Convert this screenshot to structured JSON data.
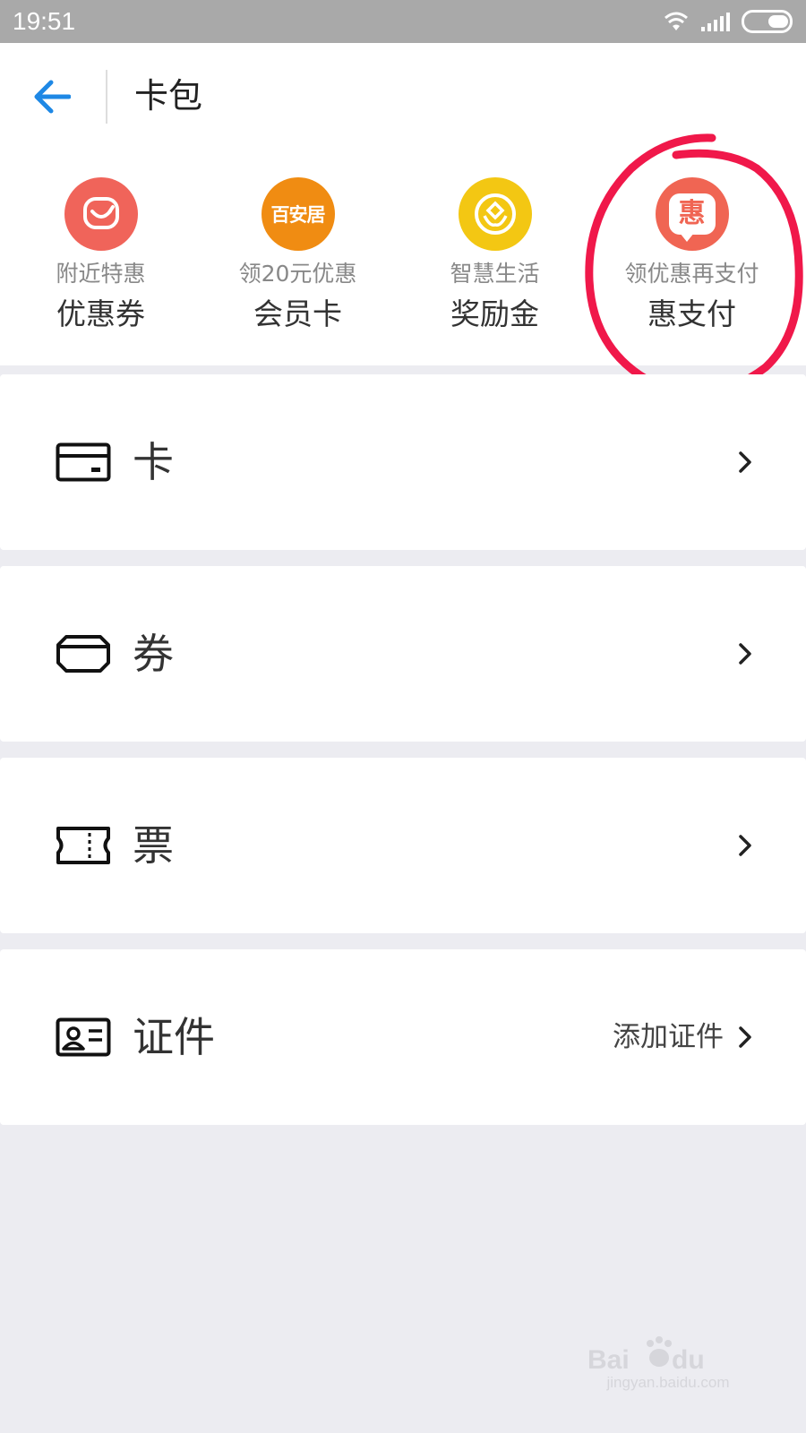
{
  "status_bar": {
    "time": "19:51",
    "icons": [
      "wifi-icon",
      "signal-icon",
      "battery-icon"
    ]
  },
  "header": {
    "title": "卡包",
    "back_icon": "back-arrow-icon",
    "accent_color": "#1e88e5"
  },
  "shortcuts": [
    {
      "subtitle": "附近特惠",
      "title": "优惠券",
      "icon": "smile-bag-icon",
      "color": "#f0645a"
    },
    {
      "subtitle": "领20元优惠",
      "title": "会员卡",
      "icon_text": "百安居",
      "icon": "baianju-logo",
      "color": "#f08c12"
    },
    {
      "subtitle": "智慧生活",
      "title": "奖励金",
      "icon": "coin-sprout-icon",
      "color": "#f3c713"
    },
    {
      "subtitle": "领优惠再支付",
      "title": "惠支付",
      "icon_text": "惠",
      "icon": "hui-chat-icon",
      "color": "#f06553"
    }
  ],
  "annotation": {
    "icon": "red-circle-highlight",
    "color": "#f0184a"
  },
  "rows": [
    {
      "label": "卡",
      "icon": "card-icon"
    },
    {
      "label": "券",
      "icon": "coupon-icon"
    },
    {
      "label": "票",
      "icon": "ticket-icon"
    },
    {
      "label": "证件",
      "icon": "id-card-icon",
      "extra": "添加证件"
    }
  ],
  "watermark": {
    "text": "jingyan.baidu.com",
    "logo": "baidu-jingyan-logo"
  }
}
